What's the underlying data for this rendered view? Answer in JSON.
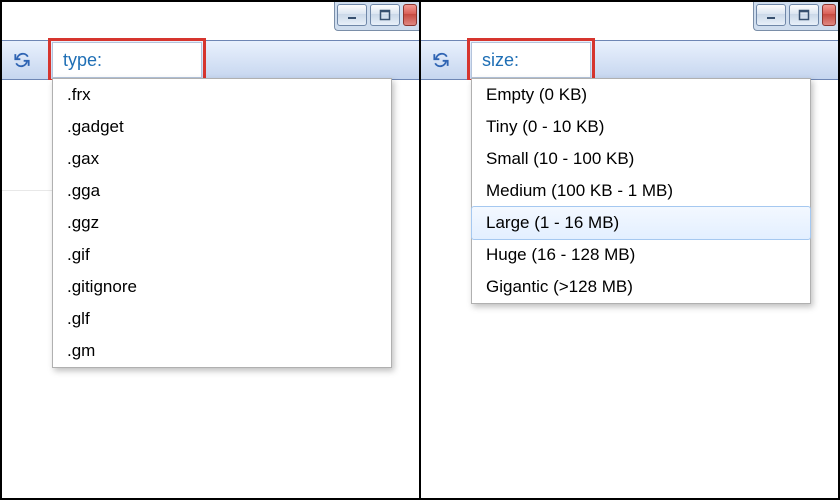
{
  "left": {
    "search_text": "type:",
    "suggestions": [
      ".frx",
      ".gadget",
      ".gax",
      ".gga",
      ".ggz",
      ".gif",
      ".gitignore",
      ".glf",
      ".gm"
    ]
  },
  "right": {
    "search_text": "size:",
    "suggestions": [
      "Empty (0 KB)",
      "Tiny (0 - 10 KB)",
      "Small (10 - 100 KB)",
      "Medium (100 KB - 1 MB)",
      "Large (1 - 16 MB)",
      "Huge (16 - 128 MB)",
      "Gigantic (>128 MB)"
    ],
    "highlighted_index": 4
  }
}
